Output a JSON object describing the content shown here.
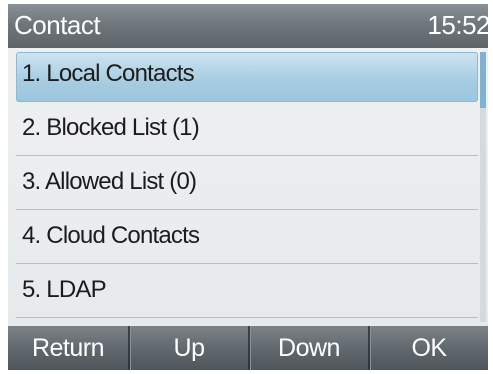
{
  "header": {
    "title": "Contact",
    "clock": "15:52"
  },
  "menu": {
    "items": [
      {
        "label": "1. Local Contacts",
        "selected": true
      },
      {
        "label": "2. Blocked List (1)",
        "selected": false
      },
      {
        "label": "3. Allowed List (0)",
        "selected": false
      },
      {
        "label": "4. Cloud Contacts",
        "selected": false
      },
      {
        "label": "5. LDAP",
        "selected": false
      }
    ]
  },
  "softkeys": {
    "return_label": "Return",
    "up_label": "Up",
    "down_label": "Down",
    "ok_label": "OK"
  },
  "colors": {
    "selection": "#a9cde2",
    "title_bar": "#6f777d",
    "softkey_bar": "#5f676d"
  }
}
